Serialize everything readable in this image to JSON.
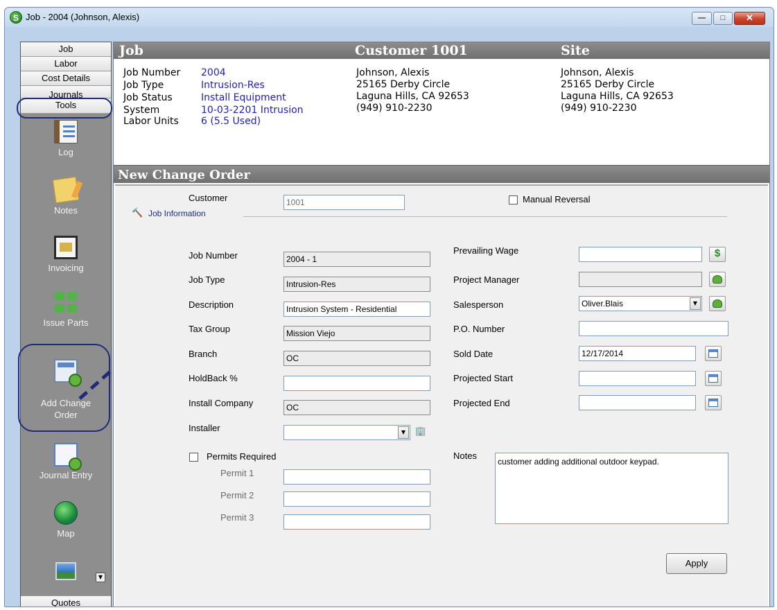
{
  "window": {
    "title": "Job - 2004 (Johnson, Alexis)",
    "icon_letter": "S",
    "min": "—",
    "max": "□",
    "close": "✕"
  },
  "sidebar": {
    "tabs": [
      "Job",
      "Labor",
      "Cost Details",
      "Journals",
      "Tools"
    ],
    "tools": [
      "Log",
      "Notes",
      "Invoicing",
      "Issue Parts",
      "Add Change\nOrder",
      "Journal Entry",
      "Map"
    ],
    "bottom_tab": "Quotes"
  },
  "header": {
    "job_title": "Job",
    "customer_title": "Customer 1001",
    "site_title": "Site",
    "job": {
      "labels": [
        "Job Number",
        "Job Type",
        "Job Status",
        "System",
        "Labor Units"
      ],
      "values": [
        "2004",
        "Intrusion-Res",
        "Install Equipment",
        "10-03-2201 Intrusion",
        "6 (5.5 Used)"
      ]
    },
    "customer": [
      "Johnson, Alexis",
      "25165 Derby Circle",
      "Laguna Hills, CA  92653",
      "(949) 910-2230"
    ],
    "site": [
      "Johnson, Alexis",
      "25165 Derby Circle",
      "Laguna Hills, CA  92653",
      "(949) 910-2230"
    ]
  },
  "change_order": {
    "title": "New Change Order",
    "customer_label": "Customer",
    "customer_value": "1001",
    "manual_reversal": "Manual Reversal",
    "job_information": "Job Information",
    "left": {
      "job_number": {
        "label": "Job Number",
        "value": "2004 - 1"
      },
      "job_type": {
        "label": "Job Type",
        "value": "Intrusion-Res"
      },
      "description": {
        "label": "Description",
        "value": "Intrusion System - Residential"
      },
      "tax_group": {
        "label": "Tax Group",
        "value": "Mission Viejo"
      },
      "branch": {
        "label": "Branch",
        "value": "OC"
      },
      "holdback": {
        "label": "HoldBack  %",
        "value": ""
      },
      "install_company": {
        "label": "Install Company",
        "value": "OC"
      },
      "installer": {
        "label": "Installer",
        "value": ""
      }
    },
    "permits": {
      "label": "Permits Required",
      "permit1": "Permit 1",
      "permit2": "Permit 2",
      "permit3": "Permit 3"
    },
    "right": {
      "prevailing_wage": {
        "label": "Prevailing Wage",
        "value": ""
      },
      "project_manager": {
        "label": "Project Manager",
        "value": ""
      },
      "salesperson": {
        "label": "Salesperson",
        "value": "Oliver.Blais"
      },
      "po_number": {
        "label": "P.O. Number",
        "value": ""
      },
      "sold_date": {
        "label": "Sold Date",
        "value": "12/17/2014"
      },
      "projected_start": {
        "label": "Projected Start",
        "value": ""
      },
      "projected_end": {
        "label": "Projected End",
        "value": ""
      }
    },
    "notes_label": "Notes",
    "notes_value": "customer adding additional outdoor keypad.",
    "apply": "Apply"
  },
  "icons": {
    "dollar": "$",
    "dropdown": "▼"
  },
  "colors": {
    "header_bar": "#7a7a7a",
    "link_blue": "#2020b8",
    "annotation": "#1f2a7a"
  }
}
